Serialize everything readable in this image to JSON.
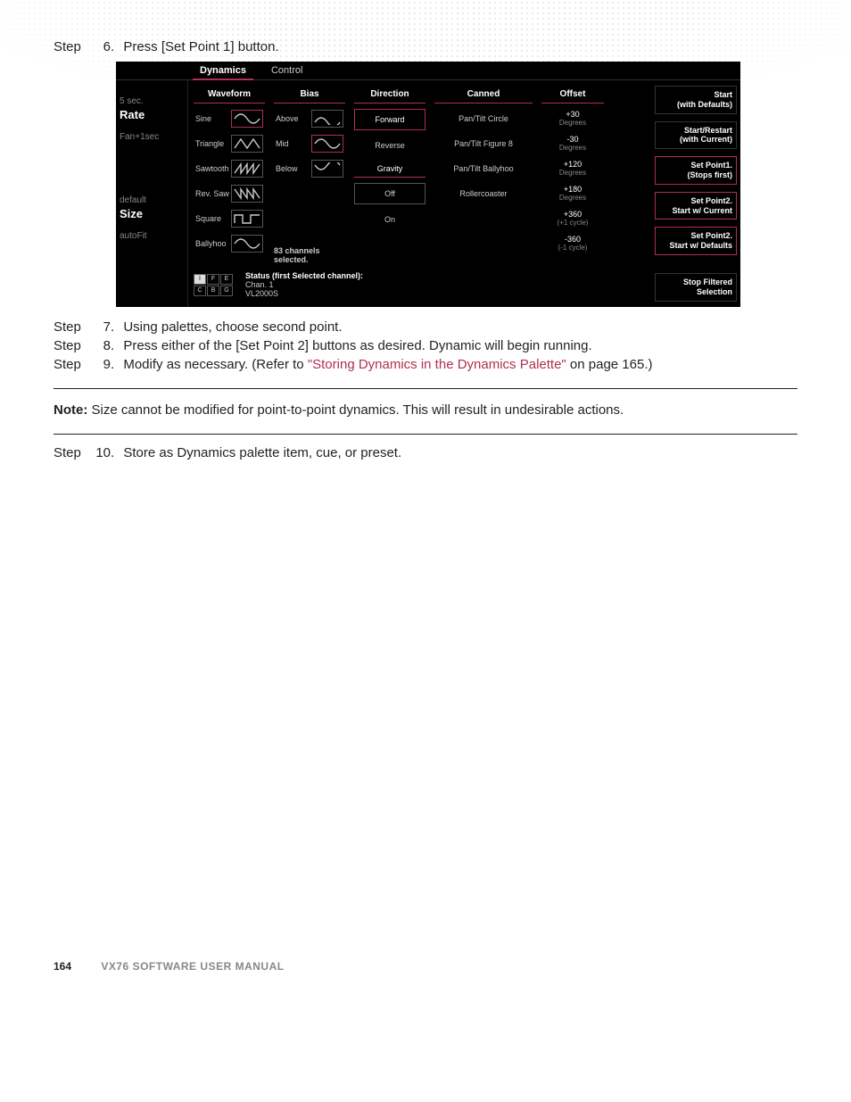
{
  "steps": {
    "s6": {
      "label": "Step",
      "num": "6.",
      "text": "Press [Set Point 1] button."
    },
    "s7": {
      "label": "Step",
      "num": "7.",
      "text": "Using palettes, choose second point."
    },
    "s8": {
      "label": "Step",
      "num": "8.",
      "text": "Press either of the [Set Point 2] buttons as desired. Dynamic will begin running."
    },
    "s9": {
      "label": "Step",
      "num": "9.",
      "pre": "Modify as necessary. (Refer to ",
      "link": "\"Storing Dynamics in the Dynamics Palette\"",
      "post": " on page 165.)"
    },
    "s10": {
      "label": "Step",
      "num": "10.",
      "text": "Store as Dynamics palette item, cue, or preset."
    }
  },
  "note": {
    "label": "Note:",
    "text": " Size cannot be modified for point-to-point dynamics. This will result in undesirable actions."
  },
  "footer": {
    "page": "164",
    "title": "VX76 SOFTWARE USER MANUAL"
  },
  "console": {
    "tabs": {
      "dynamics": "Dynamics",
      "control": "Control"
    },
    "left": {
      "l1": "5 sec.",
      "rate": "Rate",
      "l2": "Fan+1sec",
      "l3": "default",
      "size": "Size",
      "l4": "autoFit"
    },
    "headers": {
      "waveform": "Waveform",
      "bias": "Bias",
      "direction": "Direction",
      "canned": "Canned",
      "offset": "Offset"
    },
    "waveforms": [
      "Sine",
      "Triangle",
      "Sawtooth",
      "Rev. Saw",
      "Square",
      "Ballyhoo"
    ],
    "bias": [
      "Above",
      "Mid",
      "Below"
    ],
    "direction": {
      "fwd": "Forward",
      "rev": "Reverse",
      "gravHdr": "Gravity",
      "off": "Off",
      "on": "On"
    },
    "canned": [
      "Pan/Tilt Circle",
      "Pan/Tilt Figure 8",
      "Pan/Tilt Ballyhoo",
      "Rollercoaster"
    ],
    "offset": [
      {
        "v": "+30",
        "u": "Degrees"
      },
      {
        "v": "-30",
        "u": "Degrees"
      },
      {
        "v": "+120",
        "u": "Degrees"
      },
      {
        "v": "+180",
        "u": "Degrees"
      },
      {
        "v": "+360",
        "u": "(+1 cycle)"
      },
      {
        "v": "-360",
        "u": "(-1 cycle)"
      }
    ],
    "right": {
      "start": "Start\n(with Defaults)",
      "restart": "Start/Restart\n(with Current)",
      "sp1": "Set Point1.\n(Stops first)",
      "sp2a": "Set Point2.\nStart w/ Current",
      "sp2b": "Set Point2.\nStart w/ Defaults",
      "stop": "Stop Filtered\nSelection"
    },
    "chcount": "83 channels selected.",
    "status": {
      "h": "Status (first Selected channel):",
      "l1": "Chan. 1",
      "l2": "VL2000S"
    },
    "grid": [
      "I",
      "F",
      "E",
      "C",
      "B",
      "G"
    ]
  }
}
